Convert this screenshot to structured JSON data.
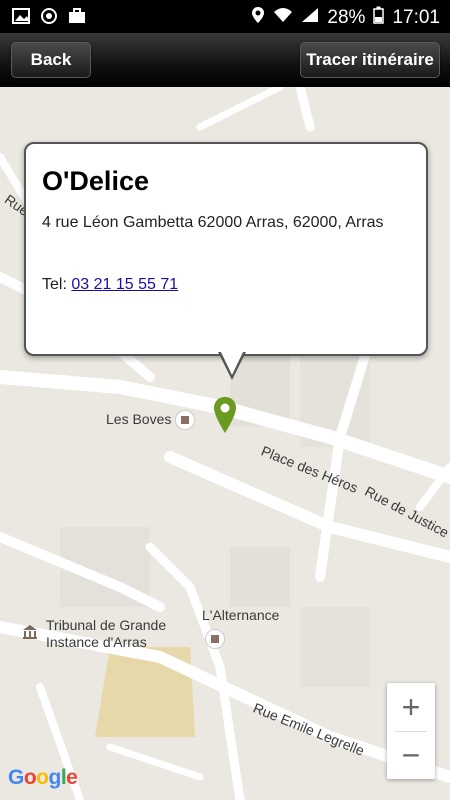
{
  "status_bar": {
    "battery": "28%",
    "time": "17:01"
  },
  "action_bar": {
    "back_label": "Back",
    "route_label": "Tracer itinéraire"
  },
  "place": {
    "name": "O'Delice",
    "address": "4 rue Léon Gambetta 62000 Arras, 62000, Arras",
    "tel_label": "Tel:",
    "tel_number": "03 21 15 55 71"
  },
  "map": {
    "labels": {
      "les_boves": "Les Boves",
      "place_des_heros": "Place des Héros",
      "rue_de_justice": "Rue de Justice",
      "lalternance": "L'Alternance",
      "tribunal_line1": "Tribunal de Grande",
      "tribunal_line2": "Instance d'Arras",
      "rue_emile_legrelle": "Rue Emile Legrelle",
      "rue_partial": "Rue"
    },
    "zoom_in": "+",
    "zoom_out": "−",
    "google_logo": "Google"
  },
  "colors": {
    "marker": "#6a9a1f",
    "link": "#1a0dab",
    "map_bg": "#ebe8e1",
    "road": "#ffffff"
  }
}
